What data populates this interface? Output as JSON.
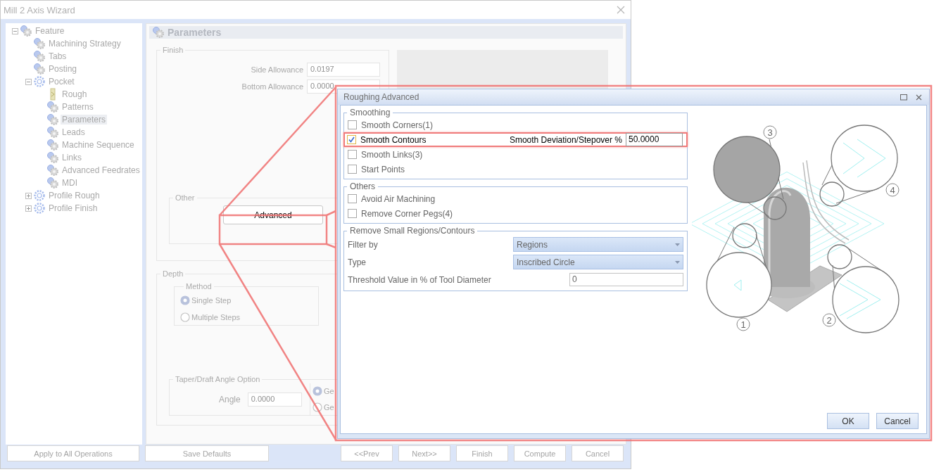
{
  "window": {
    "title": "Mill 2 Axis Wizard"
  },
  "tree": [
    {
      "label": "Feature",
      "kind": "step",
      "expanded": true,
      "selected": false,
      "children": [
        {
          "label": "Machining Strategy",
          "kind": "step",
          "selected": false
        },
        {
          "label": "Tabs",
          "kind": "step",
          "selected": false
        },
        {
          "label": "Posting",
          "kind": "step",
          "selected": false
        },
        {
          "label": "Pocket",
          "kind": "operation",
          "expanded": true,
          "selected": false,
          "children": [
            {
              "label": "Rough",
              "kind": "tool",
              "selected": false
            },
            {
              "label": "Patterns",
              "kind": "step",
              "selected": false
            },
            {
              "label": "Parameters",
              "kind": "step",
              "selected": true
            },
            {
              "label": "Leads",
              "kind": "step",
              "selected": false
            },
            {
              "label": "Machine Sequence",
              "kind": "step",
              "selected": false
            },
            {
              "label": "Links",
              "kind": "step",
              "selected": false
            },
            {
              "label": "Advanced Feedrates",
              "kind": "step",
              "selected": false
            },
            {
              "label": "MDI",
              "kind": "step",
              "selected": false
            }
          ]
        },
        {
          "label": "Profile Rough",
          "kind": "operation",
          "expanded": false,
          "selected": false
        },
        {
          "label": "Profile Finish",
          "kind": "operation",
          "expanded": false,
          "selected": false
        }
      ]
    }
  ],
  "panel": {
    "title": "Parameters",
    "finish": {
      "title": "Finish",
      "fields": [
        {
          "label": "Side Allowance",
          "value": "0.0197"
        },
        {
          "label": "Bottom Allowance",
          "value": "0.0000"
        }
      ],
      "other": {
        "title": "Other",
        "button": "Advanced"
      }
    },
    "depth": {
      "title": "Depth",
      "method": {
        "title": "Method",
        "options": [
          {
            "label": "Single Step",
            "selected": true
          },
          {
            "label": "Multiple Steps",
            "selected": false
          }
        ]
      },
      "taper": {
        "title": "Taper/Draft Angle Option",
        "angle": {
          "label": "Angle",
          "value": "0.0000"
        },
        "options": [
          {
            "label": "Ge",
            "selected": true
          },
          {
            "label": "Ge",
            "selected": false
          }
        ]
      }
    }
  },
  "footer_buttons": [
    "Apply to All Operations",
    "Save Defaults",
    "<<Prev",
    "Next>>",
    "Finish",
    "Compute",
    "Cancel"
  ],
  "dialog": {
    "title": "Roughing Advanced",
    "smoothing": {
      "title": "Smoothing",
      "items": [
        {
          "label": "Smooth Corners(1)",
          "checked": false,
          "highlighted": false
        },
        {
          "label": "Smooth Contours",
          "checked": true,
          "highlighted": true,
          "field": {
            "label": "Smooth Deviation/Stepover %",
            "value": "50.0000"
          }
        },
        {
          "label": "Smooth Links(3)",
          "checked": false,
          "highlighted": false
        },
        {
          "label": "Start Points",
          "checked": false,
          "highlighted": false
        }
      ]
    },
    "others": {
      "title": "Others",
      "items": [
        {
          "label": "Avoid Air Machining",
          "checked": false,
          "highlighted": false
        },
        {
          "label": "Remove Corner Pegs(4)",
          "checked": false,
          "highlighted": false
        }
      ]
    },
    "small_regions": {
      "title": "Remove Small Regions/Contours",
      "rows": [
        {
          "label": "Filter by",
          "kind": "dropdown",
          "value": "Regions"
        },
        {
          "label": "Type",
          "kind": "dropdown",
          "value": "Inscribed Circle"
        },
        {
          "label": "Threshold Value in % of Tool Diameter",
          "kind": "input",
          "value": "0"
        }
      ]
    },
    "illustration": {
      "callouts": [
        "1",
        "2",
        "3",
        "4"
      ]
    },
    "buttons": [
      "OK",
      "Cancel"
    ]
  }
}
